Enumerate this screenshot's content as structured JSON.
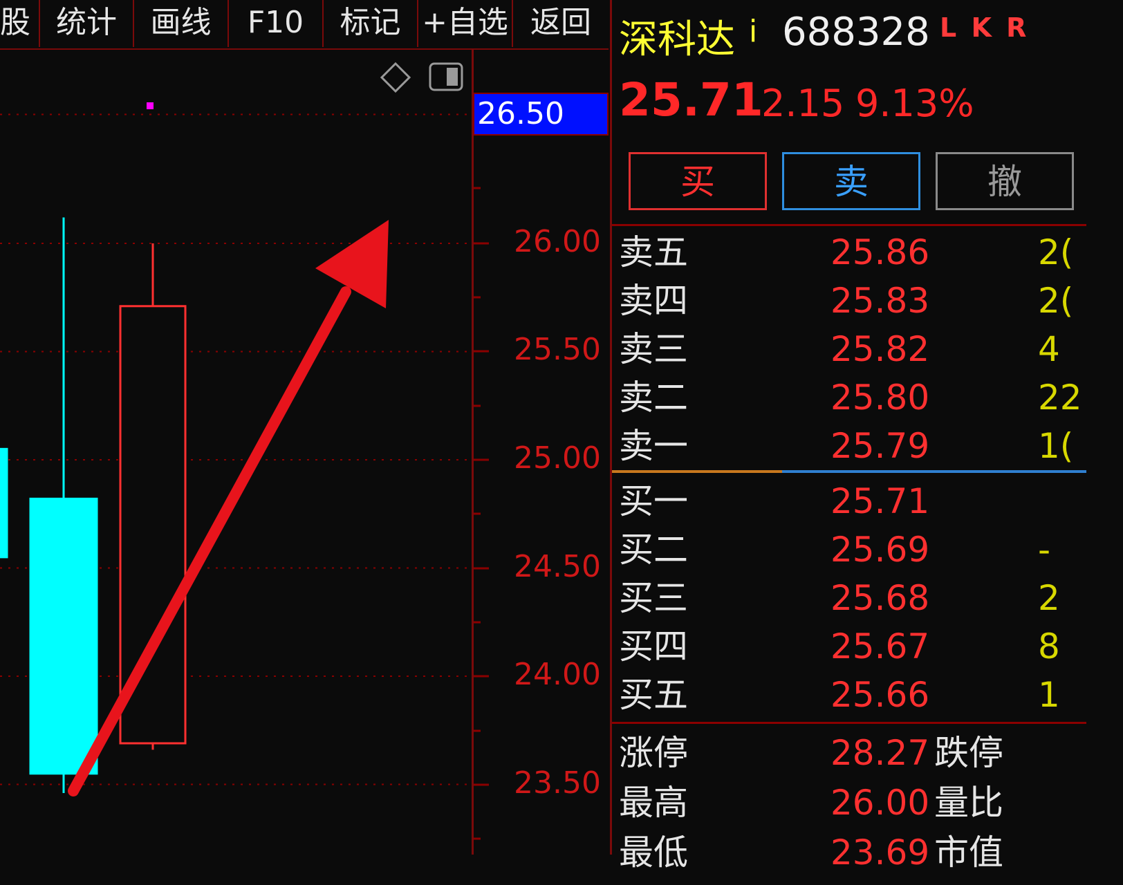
{
  "toolbar": {
    "items": [
      {
        "label": "股"
      },
      {
        "label": "统计"
      },
      {
        "label": "画线"
      },
      {
        "label": "F10"
      },
      {
        "label": "标记"
      },
      {
        "label": "+自选"
      },
      {
        "label": "返回"
      }
    ]
  },
  "chart": {
    "current_price_label": "26.50",
    "axis_ticks": [
      "26.00",
      "25.50",
      "25.00",
      "24.50",
      "24.00",
      "23.50"
    ],
    "colors": {
      "up": "#ff3030",
      "down": "#00ffff",
      "grid": "#8b0000",
      "arrow": "#e8141c"
    }
  },
  "chart_data": {
    "type": "candlestick",
    "ylim": [
      23.3,
      26.55
    ],
    "candles": [
      {
        "open": 25.05,
        "close": 24.55,
        "high": 25.05,
        "low": 24.55,
        "color": "down"
      },
      {
        "open": 24.82,
        "close": 23.55,
        "high": 26.12,
        "low": 23.46,
        "color": "down"
      },
      {
        "open": 23.69,
        "close": 25.71,
        "high": 26.0,
        "low": 23.66,
        "color": "up"
      }
    ],
    "annotations": [
      "up-arrow"
    ]
  },
  "stock": {
    "name": "深科达",
    "info_icon": "i",
    "code": "688328",
    "tags": "L K R",
    "price": "25.71",
    "change": "2.15",
    "change_pct": "9.13%"
  },
  "actions": {
    "buy": "买",
    "sell": "卖",
    "cancel": "撤"
  },
  "orderbook": {
    "asks": [
      {
        "label": "卖五",
        "price": "25.86",
        "vol": "2("
      },
      {
        "label": "卖四",
        "price": "25.83",
        "vol": "2("
      },
      {
        "label": "卖三",
        "price": "25.82",
        "vol": "4"
      },
      {
        "label": "卖二",
        "price": "25.80",
        "vol": "22"
      },
      {
        "label": "卖一",
        "price": "25.79",
        "vol": "1("
      }
    ],
    "bids": [
      {
        "label": "买一",
        "price": "25.71",
        "vol": ""
      },
      {
        "label": "买二",
        "price": "25.69",
        "vol": "-"
      },
      {
        "label": "买三",
        "price": "25.68",
        "vol": "2"
      },
      {
        "label": "买四",
        "price": "25.67",
        "vol": "8"
      },
      {
        "label": "买五",
        "price": "25.66",
        "vol": "1"
      }
    ]
  },
  "stats": [
    {
      "label": "涨停",
      "value": "28.27",
      "label2": "跌停"
    },
    {
      "label": "最高",
      "value": "26.00",
      "label2": "量比"
    },
    {
      "label": "最低",
      "value": "23.69",
      "label2": "市值"
    }
  ]
}
